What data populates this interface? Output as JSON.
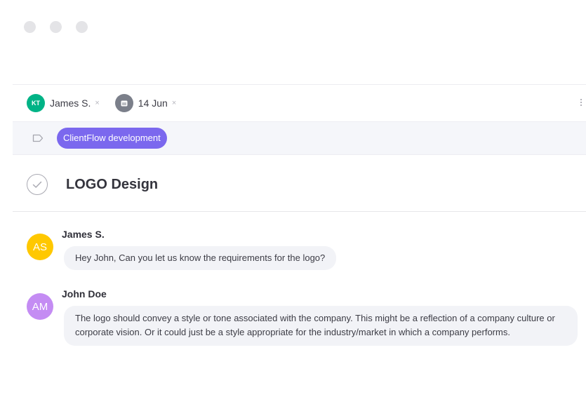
{
  "window": {
    "controls": [
      "close",
      "minimize",
      "maximize"
    ]
  },
  "meta": {
    "assignee": {
      "initials": "KT",
      "name": "James S.",
      "remove": "×"
    },
    "due_date": {
      "icon": "calendar-icon",
      "label": "14 Jun",
      "remove": "×"
    }
  },
  "tag": {
    "icon": "tag-icon",
    "label": "ClientFlow development",
    "color": "#7b68ee"
  },
  "task": {
    "title": "LOGO Design",
    "status_icon": "check-circle-icon"
  },
  "comments": [
    {
      "initials": "AS",
      "author": "James S.",
      "avatar_color": "#ffc800",
      "text": "Hey John, Can you let us know the requirements for the logo?"
    },
    {
      "initials": "AM",
      "author": "John Doe",
      "avatar_color": "#c48cf3",
      "text": "The logo should convey a style or tone associated with the company. This might be a reflection of a company culture or corporate vision. Or it could just be a style appropriate for the industry/market in which a company performs."
    }
  ]
}
